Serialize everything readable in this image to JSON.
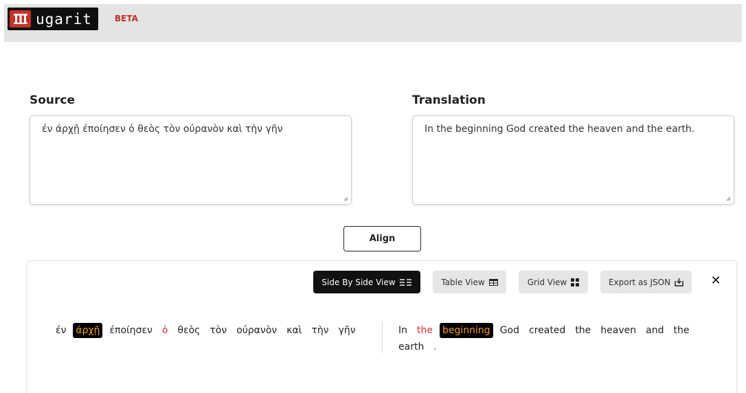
{
  "header": {
    "logo_text": "ugarit",
    "beta_label": "BETA"
  },
  "source": {
    "label": "Source",
    "value": "έν άρχῇ έποίησεν ὀ θεὸς τὸν ούρανὸν καὶ τὴν γῆν"
  },
  "translation": {
    "label": "Translation",
    "value": "In the beginning God created the heaven and the earth."
  },
  "align_button": "Align",
  "views": {
    "side_by_side": "Side By Side View",
    "table": "Table View",
    "grid": "Grid View",
    "export": "Export as JSON",
    "active": "side_by_side"
  },
  "close_label": "✕",
  "aligned_source": [
    {
      "text": "έν",
      "state": "normal"
    },
    {
      "text": "άρχῇ",
      "state": "highlighted"
    },
    {
      "text": "έποίησεν",
      "state": "normal"
    },
    {
      "text": "ὀ",
      "state": "aligned"
    },
    {
      "text": "θεὸς",
      "state": "normal"
    },
    {
      "text": "τὸν",
      "state": "normal"
    },
    {
      "text": "ούρανὸν",
      "state": "normal"
    },
    {
      "text": "καὶ",
      "state": "normal"
    },
    {
      "text": "τὴν",
      "state": "normal"
    },
    {
      "text": "γῆν",
      "state": "normal"
    }
  ],
  "aligned_translation": [
    {
      "text": "In",
      "state": "normal"
    },
    {
      "text": "the",
      "state": "aligned"
    },
    {
      "text": "beginning",
      "state": "highlighted"
    },
    {
      "text": "God",
      "state": "normal"
    },
    {
      "text": "created",
      "state": "normal"
    },
    {
      "text": "the",
      "state": "normal"
    },
    {
      "text": "heaven",
      "state": "normal"
    },
    {
      "text": "and",
      "state": "normal"
    },
    {
      "text": "the",
      "state": "normal"
    },
    {
      "text": "earth",
      "state": "normal"
    },
    {
      "text": ".",
      "state": "aligned"
    }
  ],
  "colors": {
    "brand_red": "#c8302a",
    "highlight_bg": "#000000",
    "highlight_text": "#f0a020",
    "aligned_text": "#d32f2f"
  }
}
